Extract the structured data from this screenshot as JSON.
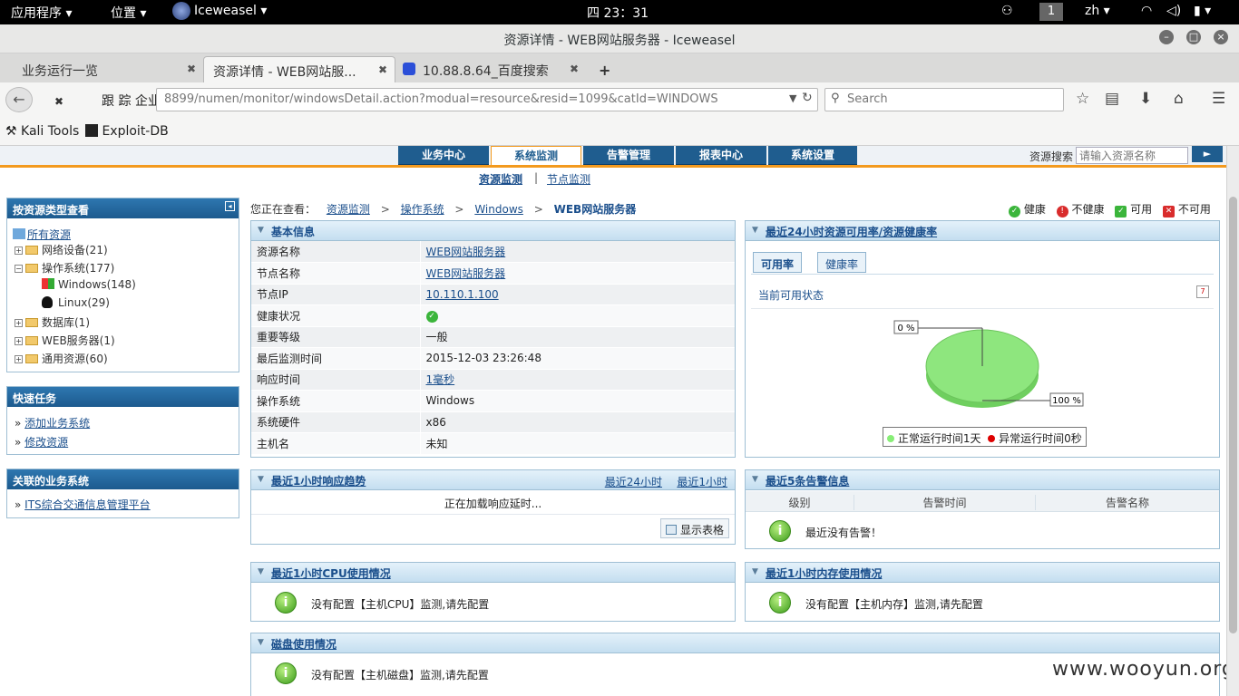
{
  "system": {
    "apps_menu": "应用程序",
    "places_menu": "位置",
    "app_name": "Iceweasel",
    "clock": "四 23：31",
    "workspace": "1",
    "lang": "zh"
  },
  "window": {
    "title": "资源详情 - WEB网站服务器 - Iceweasel"
  },
  "tabs": [
    {
      "label": "业务运行一览"
    },
    {
      "label": "资源详情 - WEB网站服..."
    },
    {
      "label": "10.88.8.64_百度搜索"
    }
  ],
  "navbar": {
    "url_prefix": "跟 踪 企业",
    "url": "8899/numen/monitor/windowsDetail.action?modual=resource&resid=1099&catId=WINDOWS",
    "search_placeholder": "Search"
  },
  "bookmarks": [
    {
      "label": "Kali Tools"
    },
    {
      "label": "Exploit-DB"
    }
  ],
  "app": {
    "main_tabs": [
      "业务中心",
      "系统监测",
      "告警管理",
      "报表中心",
      "系统设置"
    ],
    "resource_search_label": "资源搜索",
    "resource_search_placeholder": "请输入资源名称",
    "subnav": [
      "资源监测",
      "节点监测"
    ],
    "breadcrumb": {
      "prefix": "您正在查看：",
      "items": [
        "资源监测",
        "操作系统",
        "Windows"
      ],
      "current": "WEB网站服务器"
    },
    "legend": [
      "健康",
      "不健康",
      "可用",
      "不可用"
    ]
  },
  "sidebar": {
    "tree_title": "按资源类型查看",
    "tree": {
      "root": "所有资源",
      "items": [
        {
          "label": "网络设备(21)"
        },
        {
          "label": "操作系统(177)"
        },
        {
          "label": "Windows(148)"
        },
        {
          "label": "Linux(29)"
        },
        {
          "label": "数据库(1)"
        },
        {
          "label": "WEB服务器(1)"
        },
        {
          "label": "通用资源(60)"
        }
      ]
    },
    "quick_title": "快速任务",
    "quick_items": [
      "添加业务系统",
      "修改资源"
    ],
    "biz_title": "关联的业务系统",
    "biz_items": [
      "ITS综合交通信息管理平台"
    ]
  },
  "basic_info": {
    "title": "基本信息",
    "rows": [
      {
        "k": "资源名称",
        "v": "WEB网站服务器"
      },
      {
        "k": "节点名称",
        "v": "WEB网站服务器"
      },
      {
        "k": "节点IP",
        "v": "10.110.1.100"
      },
      {
        "k": "健康状况",
        "v": ""
      },
      {
        "k": "重要等级",
        "v": "一般"
      },
      {
        "k": "最后监测时间",
        "v": "2015-12-03 23:26:48"
      },
      {
        "k": "响应时间",
        "v": "1毫秒"
      },
      {
        "k": "操作系统",
        "v": "Windows"
      },
      {
        "k": "系统硬件",
        "v": "x86"
      },
      {
        "k": "主机名",
        "v": "未知"
      }
    ]
  },
  "availability": {
    "title": "最近24小时资源可用率/资源健康率",
    "tabs": [
      "可用率",
      "健康率"
    ],
    "subtitle": "当前可用状态",
    "chart_data": {
      "type": "pie",
      "categories": [
        "正常运行时间1天",
        "异常运行时间0秒"
      ],
      "values": [
        100,
        0
      ],
      "labels": [
        "100 %",
        "0 %"
      ],
      "colors": [
        "#88ee77",
        "#dd0000"
      ],
      "legend": "bottom"
    }
  },
  "response_trend": {
    "title": "最近1小时响应趋势",
    "links": [
      "最近24小时",
      "最近1小时"
    ],
    "loading": "正在加载响应延时...",
    "show_table": "显示表格"
  },
  "alarms": {
    "title": "最近5条告警信息",
    "columns": [
      "级别",
      "告警时间",
      "告警名称"
    ],
    "empty": "最近没有告警！"
  },
  "cpu": {
    "title": "最近1小时CPU使用情况",
    "msg": "没有配置【主机CPU】监测,请先配置"
  },
  "memory": {
    "title": "最近1小时内存使用情况",
    "msg": "没有配置【主机内存】监测,请先配置"
  },
  "disk": {
    "title": "磁盘使用情况",
    "msg": "没有配置【主机磁盘】监测,请先配置"
  },
  "watermark": "www.wooyun.org"
}
